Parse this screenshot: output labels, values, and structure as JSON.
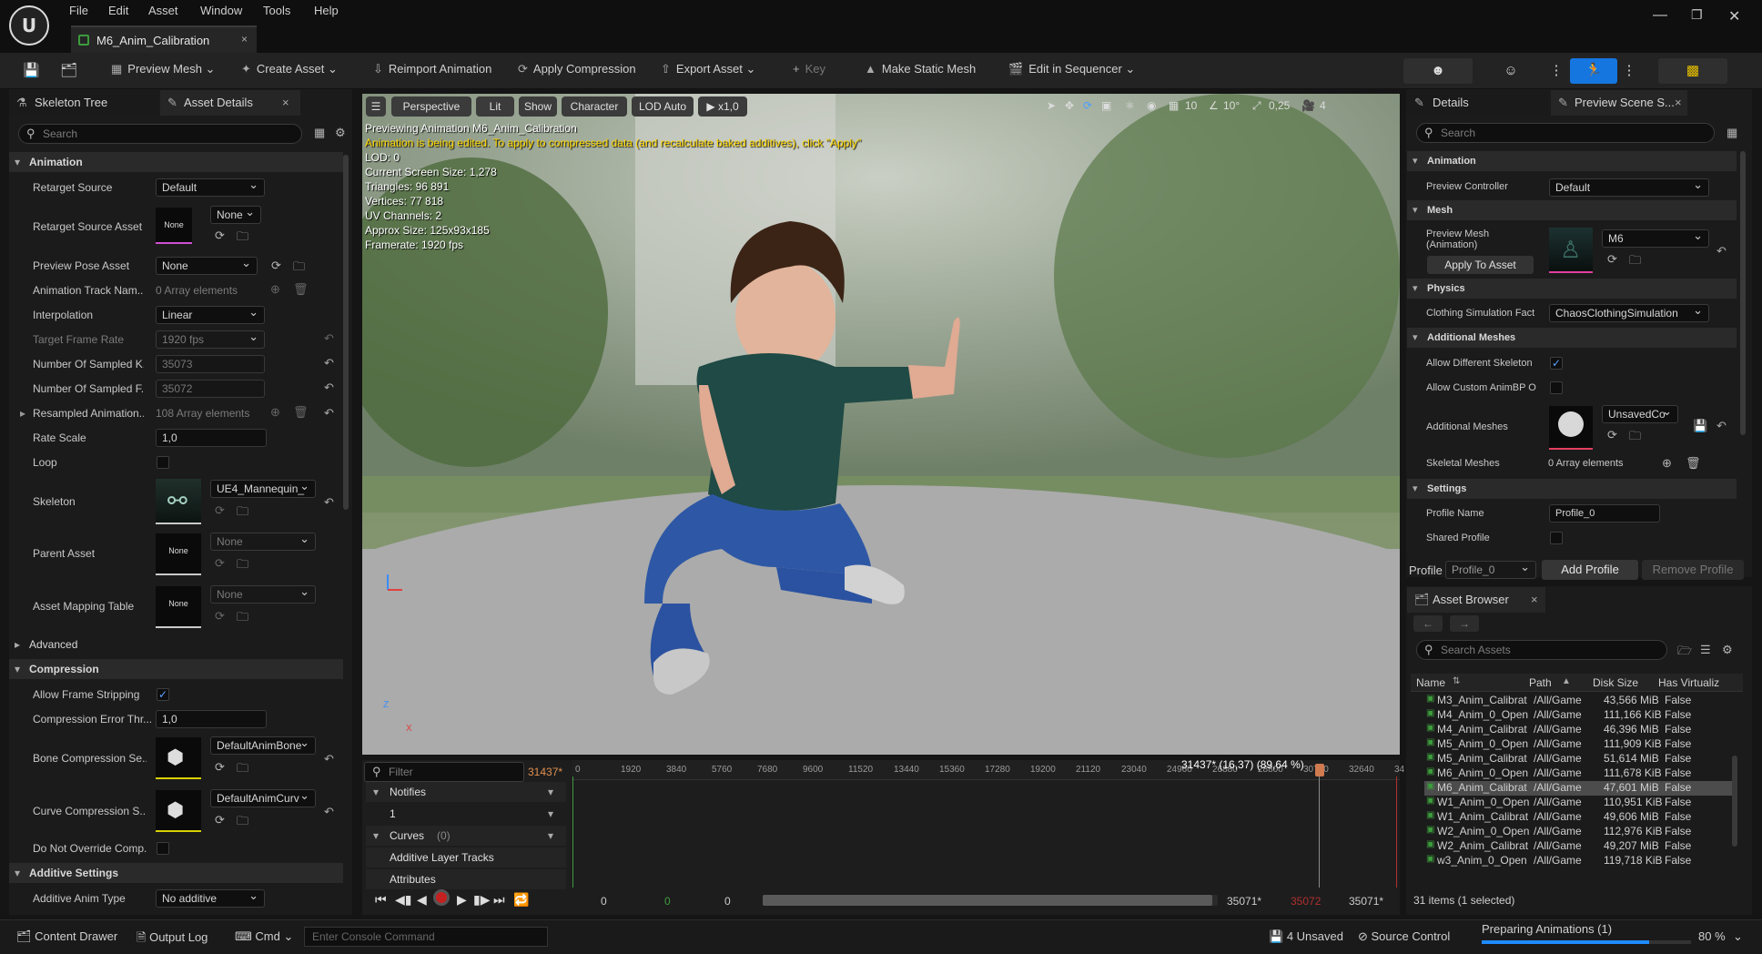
{
  "app": {
    "logo": "U"
  },
  "menu": [
    "File",
    "Edit",
    "Asset",
    "Window",
    "Tools",
    "Help"
  ],
  "doc_tab": {
    "title": "M6_Anim_Calibration",
    "close": "×"
  },
  "window_controls": {
    "minimize": "—",
    "restore": "❐",
    "close": "✕"
  },
  "toolbar": {
    "preview_mesh": "Preview Mesh",
    "create_asset": "Create Asset",
    "reimport": "Reimport Animation",
    "apply_compression": "Apply Compression",
    "export_asset": "Export Asset",
    "key": "Key",
    "make_static_mesh": "Make Static Mesh",
    "edit_in_sequencer": "Edit in Sequencer"
  },
  "left_panel": {
    "tabs": [
      "Skeleton Tree",
      "Asset Details"
    ],
    "search_placeholder": "Search",
    "sections": {
      "animation": "Animation",
      "advanced": "Advanced",
      "compression": "Compression",
      "additive": "Additive Settings"
    },
    "props": {
      "retarget_source": {
        "label": "Retarget Source",
        "value": "Default"
      },
      "retarget_source_asset": {
        "label": "Retarget Source Asset",
        "thumb": "None",
        "value": "None"
      },
      "preview_pose_asset": {
        "label": "Preview Pose Asset",
        "value": "None"
      },
      "anim_track_names": {
        "label": "Animation Track Nam...",
        "value": "0 Array elements"
      },
      "interpolation": {
        "label": "Interpolation",
        "value": "Linear"
      },
      "target_frame_rate": {
        "label": "Target Frame Rate",
        "value": "1920 fps"
      },
      "num_sampled_keys": {
        "label": "Number Of Sampled K...",
        "value": "35073"
      },
      "num_sampled_frames": {
        "label": "Number Of Sampled F...",
        "value": "35072"
      },
      "resampled_anim": {
        "label": "Resampled Animation...",
        "value": "108 Array elements"
      },
      "rate_scale": {
        "label": "Rate Scale",
        "value": "1,0"
      },
      "loop": {
        "label": "Loop"
      },
      "skeleton": {
        "label": "Skeleton",
        "value": "UE4_Mannequin_"
      },
      "parent_asset": {
        "label": "Parent Asset",
        "thumb": "None",
        "value": "None"
      },
      "asset_mapping_table": {
        "label": "Asset Mapping Table",
        "thumb": "None",
        "value": "None"
      },
      "allow_frame_stripping": {
        "label": "Allow Frame Stripping",
        "checked": "✓"
      },
      "compression_error_thr": {
        "label": "Compression Error Thr...",
        "value": "1,0"
      },
      "bone_compression": {
        "label": "Bone Compression Se...",
        "value": "DefaultAnimBone"
      },
      "curve_compression": {
        "label": "Curve Compression S...",
        "value": "DefaultAnimCurv"
      },
      "do_not_override": {
        "label": "Do Not Override Comp..."
      },
      "additive_anim_type": {
        "label": "Additive Anim Type",
        "value": "No additive"
      }
    }
  },
  "viewport": {
    "buttons": {
      "perspective": "Perspective",
      "lit": "Lit",
      "show": "Show",
      "character": "Character",
      "lod": "LOD Auto",
      "speed": "x1,0"
    },
    "right_icons": {
      "grid": "10",
      "angle": "10°",
      "scale": "0,25",
      "camera": "4"
    },
    "overlay": [
      "Previewing Animation M6_Anim_Calibration",
      "Animation is being edited. To apply to compressed data (and recalculate baked additives), click \"Apply\"",
      "LOD: 0",
      "Current Screen Size: 1,278",
      "Triangles: 96 891",
      "Vertices: 77 818",
      "UV Channels: 2",
      "Approx Size: 125x93x185",
      "Framerate: 1920 fps"
    ],
    "overlay_warning_color": "#ffd800",
    "axis": {
      "z": "Z",
      "x": "X"
    }
  },
  "timeline": {
    "filter_placeholder": "Filter",
    "current_frame": "31437*",
    "playhead_label": "31437* (16,37) (89,64 %)",
    "ticks": [
      "0",
      "1920",
      "3840",
      "5760",
      "7680",
      "9600",
      "11520",
      "13440",
      "15360",
      "17280",
      "19200",
      "21120",
      "23040",
      "24960",
      "26880",
      "28800",
      "30720",
      "32640",
      "34"
    ],
    "tracks": {
      "notifies": "Notifies",
      "one": "1",
      "curves": "Curves",
      "curves_count": "(0)",
      "additive": "Additive Layer Tracks",
      "attributes": "Attributes"
    },
    "bottom": {
      "start1": "0",
      "start2": "0",
      "start3": "0",
      "end1": "35071*",
      "end2": "35072",
      "end3": "35071*"
    }
  },
  "right_panel": {
    "tabs": [
      "Details",
      "Preview Scene S..."
    ],
    "search_placeholder": "Search",
    "sections": {
      "animation": "Animation",
      "mesh": "Mesh",
      "physics": "Physics",
      "additional_meshes": "Additional Meshes",
      "settings": "Settings"
    },
    "props": {
      "preview_controller": {
        "label": "Preview Controller",
        "value": "Default"
      },
      "preview_mesh": {
        "label": "Preview Mesh (Animation)",
        "value": "M6",
        "button": "Apply To Asset"
      },
      "clothing_sim": {
        "label": "Clothing Simulation Fact",
        "value": "ChaosClothingSimulation"
      },
      "allow_diff_skeleton": {
        "label": "Allow Different Skeleton",
        "checked": "✓"
      },
      "allow_custom_animbp": {
        "label": "Allow Custom AnimBP O"
      },
      "additional_meshes": {
        "label": "Additional Meshes",
        "value": "UnsavedCo"
      },
      "skeletal_meshes": {
        "label": "Skeletal Meshes",
        "value": "0 Array elements"
      },
      "profile_name": {
        "label": "Profile Name",
        "value": "Profile_0"
      },
      "shared_profile": {
        "label": "Shared Profile"
      }
    },
    "profile": {
      "label": "Profile",
      "value": "Profile_0",
      "add": "Add Profile",
      "remove": "Remove Profile"
    }
  },
  "asset_browser": {
    "title": "Asset Browser",
    "search_placeholder": "Search Assets",
    "columns": [
      "Name",
      "Path",
      "Disk Size",
      "Has Virtualiz"
    ],
    "rows": [
      [
        "M3_Anim_Calibrat",
        "/All/Game",
        "43,566 MiB",
        "False"
      ],
      [
        "M4_Anim_0_Open",
        "/All/Game",
        "111,166 KiB",
        "False"
      ],
      [
        "M4_Anim_Calibrat",
        "/All/Game",
        "46,396 MiB",
        "False"
      ],
      [
        "M5_Anim_0_Open",
        "/All/Game",
        "111,909 KiB",
        "False"
      ],
      [
        "M5_Anim_Calibrat",
        "/All/Game",
        "51,614 MiB",
        "False"
      ],
      [
        "M6_Anim_0_Open",
        "/All/Game",
        "111,678 KiB",
        "False"
      ],
      [
        "M6_Anim_Calibrat",
        "/All/Game",
        "47,601 MiB",
        "False"
      ],
      [
        "W1_Anim_0_Open",
        "/All/Game",
        "110,951 KiB",
        "False"
      ],
      [
        "W1_Anim_Calibrat",
        "/All/Game",
        "49,606 MiB",
        "False"
      ],
      [
        "W2_Anim_0_Open",
        "/All/Game",
        "112,976 KiB",
        "False"
      ],
      [
        "W2_Anim_Calibrat",
        "/All/Game",
        "49,207 MiB",
        "False"
      ],
      [
        "w3_Anim_0_Open",
        "/All/Game",
        "119,718 KiB",
        "False"
      ]
    ],
    "selected_index": 6,
    "footer": "31 items (1 selected)"
  },
  "status": {
    "content_drawer": "Content Drawer",
    "output_log": "Output Log",
    "cmd": "Cmd",
    "console_placeholder": "Enter Console Command",
    "unsaved": "4 Unsaved",
    "source_control": "Source Control",
    "progress_label": "Preparing Animations (1)",
    "progress_value": 0.8,
    "progress_text": "80 %"
  }
}
